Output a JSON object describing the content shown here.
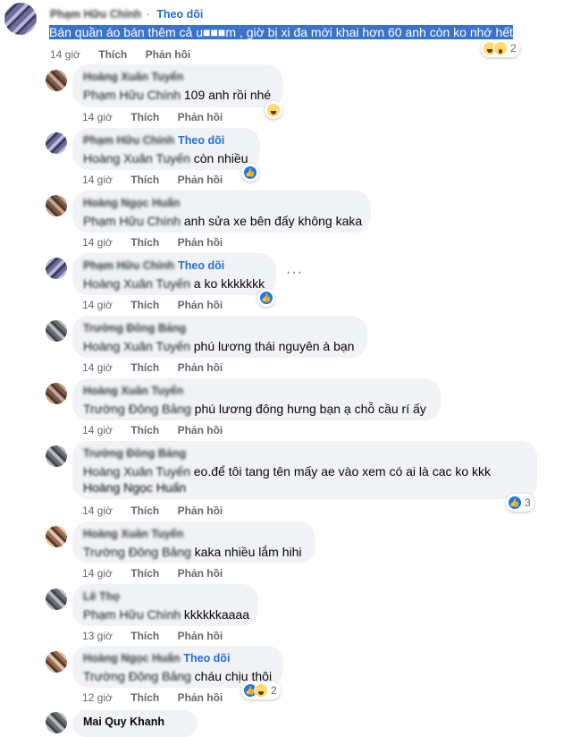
{
  "main_comment": {
    "author": "Phạm Hữu Chính",
    "follow": "Theo dõi",
    "text": "Bán quần áo bán thêm cả u■■■m , giờ bị xi đa mới khai hơn 60 anh còn ko nhớ hết",
    "time": "14 giờ",
    "like": "Thích",
    "reply": "Phản hồi",
    "reaction_count": "2"
  },
  "replies": [
    {
      "author": "Hoàng Xuân Tuyến",
      "follow": "",
      "tag": "Phạm Hữu Chính",
      "text": "109 anh rồi nhé",
      "line3": "",
      "time": "14 giờ",
      "like": "Thích",
      "reply": "Phản hồi",
      "reaction_count": ""
    },
    {
      "author": "Phạm Hữu Chính",
      "follow": "Theo dõi",
      "tag": "Hoàng Xuân Tuyến",
      "text": "còn nhiều",
      "line3": "",
      "time": "14 giờ",
      "like": "Thích",
      "reply": "Phản hồi",
      "reaction_count": ""
    },
    {
      "author": "Hoàng Ngọc Huấn",
      "follow": "",
      "tag": "Phạm Hữu Chính",
      "text": "anh sửa xe bên đấy không kaka",
      "line3": "",
      "time": "14 giờ",
      "like": "Thích",
      "reply": "Phản hồi",
      "reaction_count": ""
    },
    {
      "author": "Phạm Hữu Chính",
      "follow": "Theo dõi",
      "tag": "Hoàng Xuân Tuyến",
      "text": "a ko kkkkkkk",
      "line3": "",
      "time": "14 giờ",
      "like": "Thích",
      "reply": "Phản hồi",
      "reaction_count": ""
    },
    {
      "author": "Trường Đông Bảng",
      "follow": "",
      "tag": "Hoàng Xuân Tuyến",
      "text": "phú lương thái nguyên à bạn",
      "line3": "",
      "time": "14 giờ",
      "like": "Thích",
      "reply": "Phản hồi",
      "reaction_count": ""
    },
    {
      "author": "Hoàng Xuân Tuyến",
      "follow": "",
      "tag": "Trường Đông Bảng",
      "text": "phú lương đông hưng bạn ạ chỗ cầu rí ấy",
      "line3": "",
      "time": "14 giờ",
      "like": "Thích",
      "reply": "Phản hồi",
      "reaction_count": ""
    },
    {
      "author": "Trường Đông Bảng",
      "follow": "",
      "tag": "Hoàng Xuân Tuyến",
      "text": "eo.để tôi tang tên mấy ae vào xem có ai là cac ko kkk",
      "line3": "Hoàng Ngọc Huấn",
      "time": "14 giờ",
      "like": "Thích",
      "reply": "Phản hồi",
      "reaction_count": "3"
    },
    {
      "author": "Hoàng Xuân Tuyến",
      "follow": "",
      "tag": "Trường Đông Bảng",
      "text": "kaka nhiều lắm hihi",
      "line3": "",
      "time": "14 giờ",
      "like": "Thích",
      "reply": "Phản hồi",
      "reaction_count": ""
    },
    {
      "author": "Lê Thọ",
      "follow": "",
      "tag": "Phạm Hữu Chính",
      "text": "kkkkkkaaaa",
      "line3": "",
      "time": "13 giờ",
      "like": "Thích",
      "reply": "Phản hồi",
      "reaction_count": ""
    },
    {
      "author": "Hoàng Ngọc Huấn",
      "follow": "Theo dõi",
      "tag": "Trường Đông Bảng",
      "text": "cháu chịu thôi",
      "line3": "",
      "time": "12 giờ",
      "like": "Thích",
      "reply": "Phản hồi",
      "reaction_count": "2"
    },
    {
      "author": "Mai Quy Khanh",
      "follow": "",
      "tag": "",
      "text": "",
      "line3": "",
      "time": "",
      "like": "",
      "reply": "",
      "reaction_count": ""
    }
  ]
}
